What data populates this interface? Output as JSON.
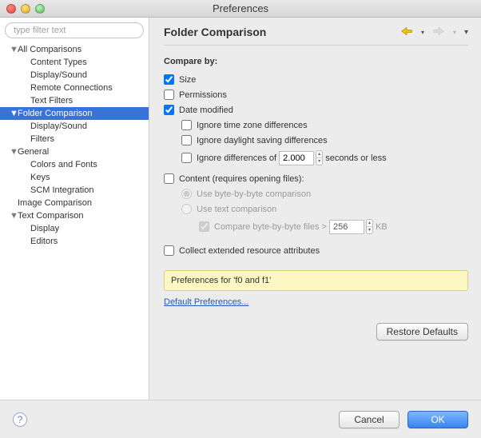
{
  "window": {
    "title": "Preferences"
  },
  "sidebar": {
    "filter_placeholder": "type filter text",
    "items": [
      {
        "label": "All Comparisons",
        "level": 0,
        "expanded": true
      },
      {
        "label": "Content Types",
        "level": 1
      },
      {
        "label": "Display/Sound",
        "level": 1
      },
      {
        "label": "Remote Connections",
        "level": 1
      },
      {
        "label": "Text Filters",
        "level": 1
      },
      {
        "label": "Folder Comparison",
        "level": 0,
        "expanded": true,
        "selected": true
      },
      {
        "label": "Display/Sound",
        "level": 1
      },
      {
        "label": "Filters",
        "level": 1
      },
      {
        "label": "General",
        "level": 0,
        "expanded": true
      },
      {
        "label": "Colors and Fonts",
        "level": 1
      },
      {
        "label": "Keys",
        "level": 1
      },
      {
        "label": "SCM Integration",
        "level": 1
      },
      {
        "label": "Image Comparison",
        "level": 0
      },
      {
        "label": "Text Comparison",
        "level": 0,
        "expanded": true
      },
      {
        "label": "Display",
        "level": 1
      },
      {
        "label": "Editors",
        "level": 1
      }
    ]
  },
  "main": {
    "title": "Folder Comparison",
    "compare_by_label": "Compare by:",
    "size_label": "Size",
    "permissions_label": "Permissions",
    "date_label": "Date modified",
    "ignore_tz_label": "Ignore time zone differences",
    "ignore_dst_label": "Ignore daylight saving differences",
    "ignore_diff_prefix": "Ignore differences of",
    "ignore_diff_value": "2.000",
    "ignore_diff_suffix": "seconds or less",
    "content_label": "Content (requires opening files):",
    "radio_byte_label": "Use byte-by-byte comparison",
    "radio_text_label": "Use text comparison",
    "compare_byte_prefix": "Compare byte-by-byte files >",
    "compare_byte_value": "256",
    "compare_byte_suffix": "KB",
    "collect_label": "Collect extended resource attributes",
    "preferences_for": "Preferences for 'f0 and f1'",
    "default_link": "Default Preferences...",
    "restore_label": "Restore Defaults"
  },
  "footer": {
    "cancel": "Cancel",
    "ok": "OK"
  },
  "checks": {
    "size": true,
    "permissions": false,
    "date": true,
    "ignore_tz": false,
    "ignore_dst": false,
    "ignore_diff": false,
    "content": false,
    "compare_byte": true,
    "collect": false
  }
}
